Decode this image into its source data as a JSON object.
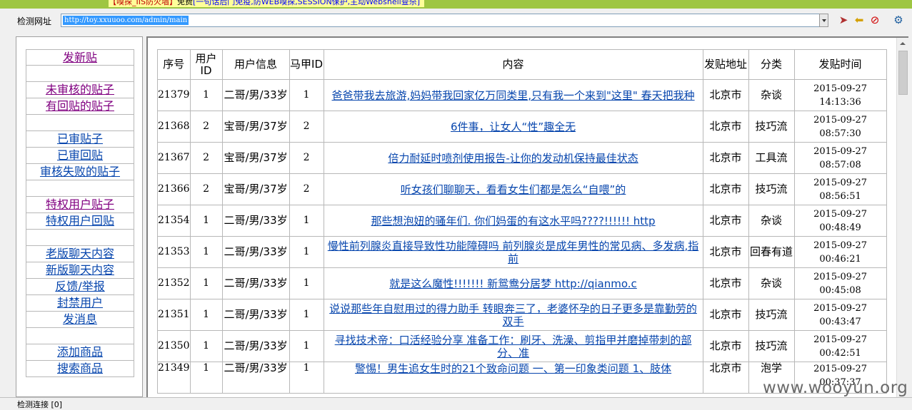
{
  "banner": {
    "part1": "【嗅探_IIS防火墙】",
    "part2": "免费",
    "part3": "[一句话后门免疫,防WEB嗅探,SESSION保护,主动Webshell查杀]"
  },
  "toolbar": {
    "address_label": "检测网址",
    "address_value": "http://toy.xxuuoo.com/admin/main"
  },
  "sidebar": {
    "items": [
      {
        "label": "发新贴",
        "visited": true
      },
      {
        "label": ""
      },
      {
        "label": "未审核的贴子",
        "visited": true
      },
      {
        "label": "有回贴的贴子",
        "visited": true
      },
      {
        "label": ""
      },
      {
        "label": "已审贴子",
        "visited": false
      },
      {
        "label": "已审回贴",
        "visited": false
      },
      {
        "label": "审核失败的贴子",
        "visited": false
      },
      {
        "label": ""
      },
      {
        "label": "特权用户贴子",
        "visited": true
      },
      {
        "label": "特权用户回贴",
        "visited": false
      },
      {
        "label": ""
      },
      {
        "label": "老版聊天内容",
        "visited": false
      },
      {
        "label": "新版聊天内容",
        "visited": false
      },
      {
        "label": "反馈/举报",
        "visited": false
      },
      {
        "label": "封禁用户",
        "visited": false
      },
      {
        "label": "发消息",
        "visited": false
      },
      {
        "label": ""
      },
      {
        "label": "添加商品",
        "visited": false
      },
      {
        "label": "搜索商品",
        "visited": false
      }
    ]
  },
  "table": {
    "headers": {
      "seq": "序号",
      "uid": "用户ID",
      "uinfo": "用户信息",
      "mjid": "马甲ID",
      "content": "内容",
      "location": "发贴地址",
      "category": "分类",
      "time": "发贴时间"
    },
    "rows": [
      {
        "seq": "21379",
        "uid": "1",
        "uinfo": "二哥/男/33岁",
        "mjid": "1",
        "content": "爸爸带我去旅游,妈妈带我回家亿万同类里,只有我一个来到\"这里\" 春天把我种",
        "location": "北京市",
        "category": "杂谈",
        "date": "2015-09-27",
        "clock": "14:13:36"
      },
      {
        "seq": "21368",
        "uid": "2",
        "uinfo": "宝哥/男/37岁",
        "mjid": "2",
        "content": "6件事，让女人“性”趣全无",
        "location": "北京市",
        "category": "技巧流",
        "date": "2015-09-27",
        "clock": "08:57:30"
      },
      {
        "seq": "21367",
        "uid": "2",
        "uinfo": "宝哥/男/37岁",
        "mjid": "2",
        "content": "倍力耐延时喷剂使用报告-让你的发动机保持最佳状态",
        "location": "北京市",
        "category": "工具流",
        "date": "2015-09-27",
        "clock": "08:57:08"
      },
      {
        "seq": "21366",
        "uid": "2",
        "uinfo": "宝哥/男/37岁",
        "mjid": "2",
        "content": "听女孩们聊聊天，看看女生们都是怎么“自喂”的",
        "location": "北京市",
        "category": "技巧流",
        "date": "2015-09-27",
        "clock": "08:56:51"
      },
      {
        "seq": "21354",
        "uid": "1",
        "uinfo": "二哥/男/33岁",
        "mjid": "1",
        "content": "那些想泡妞的骚年们. 你们妈蛋的有这水平吗????!!!!!! http",
        "location": "北京市",
        "category": "杂谈",
        "date": "2015-09-27",
        "clock": "00:48:49"
      },
      {
        "seq": "21353",
        "uid": "1",
        "uinfo": "二哥/男/33岁",
        "mjid": "1",
        "content": "慢性前列腺炎直接导致性功能障碍吗  前列腺炎是成年男性的常见病、多发病,指前",
        "location": "北京市",
        "category": "回春有道",
        "date": "2015-09-27",
        "clock": "00:46:21"
      },
      {
        "seq": "21352",
        "uid": "1",
        "uinfo": "二哥/男/33岁",
        "mjid": "1",
        "content": "就是这么魔性!!!!!!! 新鸳鸯分居梦  http://qianmo.c",
        "location": "北京市",
        "category": "杂谈",
        "date": "2015-09-27",
        "clock": "00:45:08"
      },
      {
        "seq": "21351",
        "uid": "1",
        "uinfo": "二哥/男/33岁",
        "mjid": "1",
        "content": "说说那些年自慰用过的得力助手  转眼奔三了，老婆怀孕的日子更多是靠勤劳的双手",
        "location": "北京市",
        "category": "技巧流",
        "date": "2015-09-27",
        "clock": "00:43:47"
      },
      {
        "seq": "21350",
        "uid": "1",
        "uinfo": "二哥/男/33岁",
        "mjid": "1",
        "content": "寻找技术帝：口活经验分享  准备工作：刷牙、洗澡、剪指甲并磨掉带刺的部分、准",
        "location": "北京市",
        "category": "技巧流",
        "date": "2015-09-27",
        "clock": "00:42:51"
      },
      {
        "seq": "21349",
        "uid": "1",
        "uinfo": "二哥/男/33岁",
        "mjid": "1",
        "content": "警惕！男生追女生时的21个致命问题  一、第一印象类问题  1、肢体",
        "location": "北京市",
        "category": "泡学",
        "date": "2015-09-27",
        "clock": "00:37:37"
      }
    ]
  },
  "status": {
    "text": "检测连接 [0]"
  },
  "watermark": {
    "text": "www.wooyun.org"
  }
}
